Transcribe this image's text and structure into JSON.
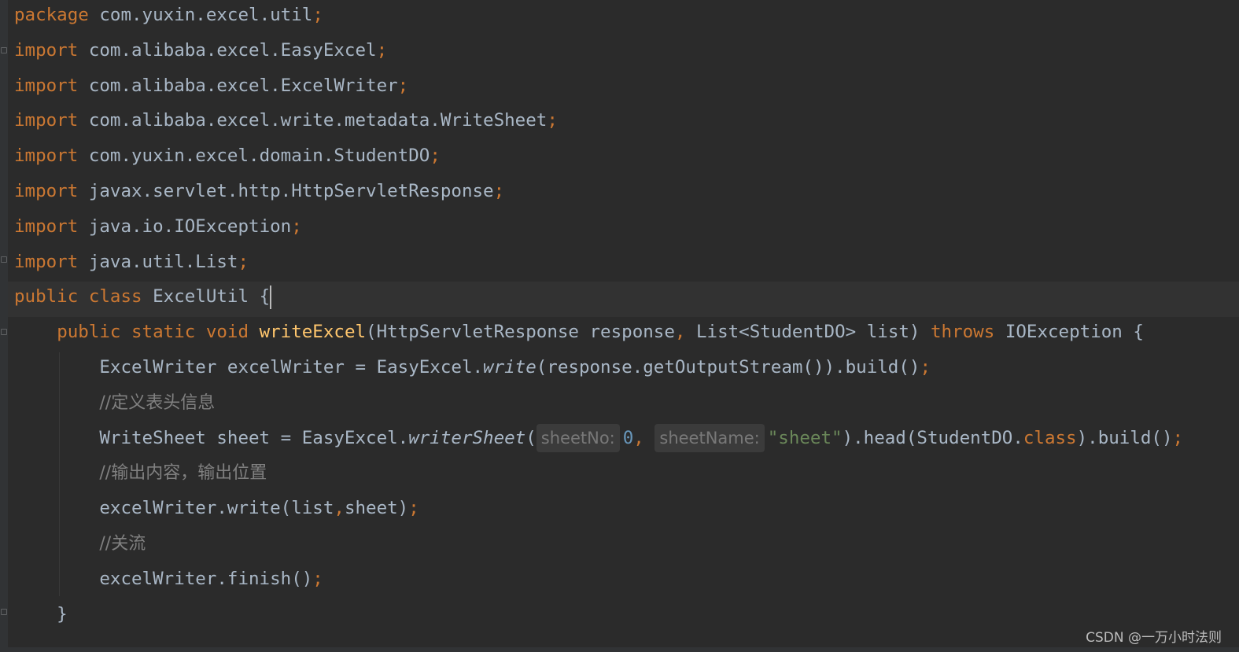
{
  "editor": {
    "lines": [
      {
        "tokens": [
          {
            "t": "package",
            "c": "kw"
          },
          {
            "t": " com.yuxin.excel.util"
          },
          {
            "t": ";",
            "c": "pn"
          }
        ]
      },
      {
        "tokens": [
          {
            "t": "import",
            "c": "kw"
          },
          {
            "t": " com.alibaba.excel.EasyExcel"
          },
          {
            "t": ";",
            "c": "pn"
          }
        ]
      },
      {
        "tokens": [
          {
            "t": "import",
            "c": "kw"
          },
          {
            "t": " com.alibaba.excel.ExcelWriter"
          },
          {
            "t": ";",
            "c": "pn"
          }
        ]
      },
      {
        "tokens": [
          {
            "t": "import",
            "c": "kw"
          },
          {
            "t": " com.alibaba.excel.write.metadata.WriteSheet"
          },
          {
            "t": ";",
            "c": "pn"
          }
        ]
      },
      {
        "tokens": [
          {
            "t": "import",
            "c": "kw"
          },
          {
            "t": " com.yuxin.excel.domain.StudentDO"
          },
          {
            "t": ";",
            "c": "pn"
          }
        ]
      },
      {
        "tokens": [
          {
            "t": "import",
            "c": "kw"
          },
          {
            "t": " javax.servlet.http.HttpServletResponse"
          },
          {
            "t": ";",
            "c": "pn"
          }
        ]
      },
      {
        "tokens": [
          {
            "t": "import",
            "c": "kw"
          },
          {
            "t": " java.io.IOException"
          },
          {
            "t": ";",
            "c": "pn"
          }
        ]
      },
      {
        "tokens": [
          {
            "t": "import",
            "c": "kw"
          },
          {
            "t": " java.util.List"
          },
          {
            "t": ";",
            "c": "pn"
          }
        ]
      },
      {
        "current": true,
        "tokens": [
          {
            "t": "public class",
            "c": "kw"
          },
          {
            "t": " ExcelUtil {"
          }
        ]
      },
      {
        "tokens": [
          {
            "t": "    "
          },
          {
            "t": "public static void",
            "c": "kw"
          },
          {
            "t": " "
          },
          {
            "t": "writeExcel",
            "c": "fn"
          },
          {
            "t": "(HttpServletResponse response"
          },
          {
            "t": ",",
            "c": "pn"
          },
          {
            "t": " List<StudentDO> list) "
          },
          {
            "t": "throws",
            "c": "kw"
          },
          {
            "t": " IOException {"
          }
        ]
      },
      {
        "tokens": [
          {
            "t": "        ExcelWriter excelWriter = EasyExcel."
          },
          {
            "t": "write",
            "c": "it"
          },
          {
            "t": "(response.getOutputStream()).build()"
          },
          {
            "t": ";",
            "c": "pn"
          }
        ]
      },
      {
        "tokens": [
          {
            "t": "        "
          },
          {
            "t": "//定义表头信息",
            "c": "cm"
          }
        ]
      },
      {
        "tokens": [
          {
            "t": "        WriteSheet sheet = EasyExcel."
          },
          {
            "t": "writerSheet",
            "c": "it"
          },
          {
            "t": "("
          },
          {
            "t": "sheetNo:",
            "c": "hint"
          },
          {
            "t": "0",
            "c": "num"
          },
          {
            "t": ", ",
            "c": "pn"
          },
          {
            "t": "sheetName:",
            "c": "hint"
          },
          {
            "t": "\"sheet\"",
            "c": "str"
          },
          {
            "t": ").head(StudentDO."
          },
          {
            "t": "class",
            "c": "kw"
          },
          {
            "t": ").build()"
          },
          {
            "t": ";",
            "c": "pn"
          }
        ]
      },
      {
        "tokens": [
          {
            "t": "        "
          },
          {
            "t": "//输出内容，输出位置",
            "c": "cm"
          }
        ]
      },
      {
        "tokens": [
          {
            "t": "        excelWriter.write(list"
          },
          {
            "t": ",",
            "c": "pn"
          },
          {
            "t": "sheet)"
          },
          {
            "t": ";",
            "c": "pn"
          }
        ]
      },
      {
        "tokens": [
          {
            "t": "        "
          },
          {
            "t": "//关流",
            "c": "cm"
          }
        ]
      },
      {
        "tokens": [
          {
            "t": "        excelWriter.finish()"
          },
          {
            "t": ";",
            "c": "pn"
          }
        ]
      },
      {
        "tokens": [
          {
            "t": "    }"
          }
        ]
      }
    ]
  },
  "watermark": "CSDN @一万小时法则",
  "colors": {
    "background": "#2b2b2b",
    "text": "#a9b7c6",
    "keyword": "#cc7832",
    "function": "#ffc66d",
    "string": "#6a8759",
    "number": "#6897bb",
    "comment": "#808080"
  }
}
